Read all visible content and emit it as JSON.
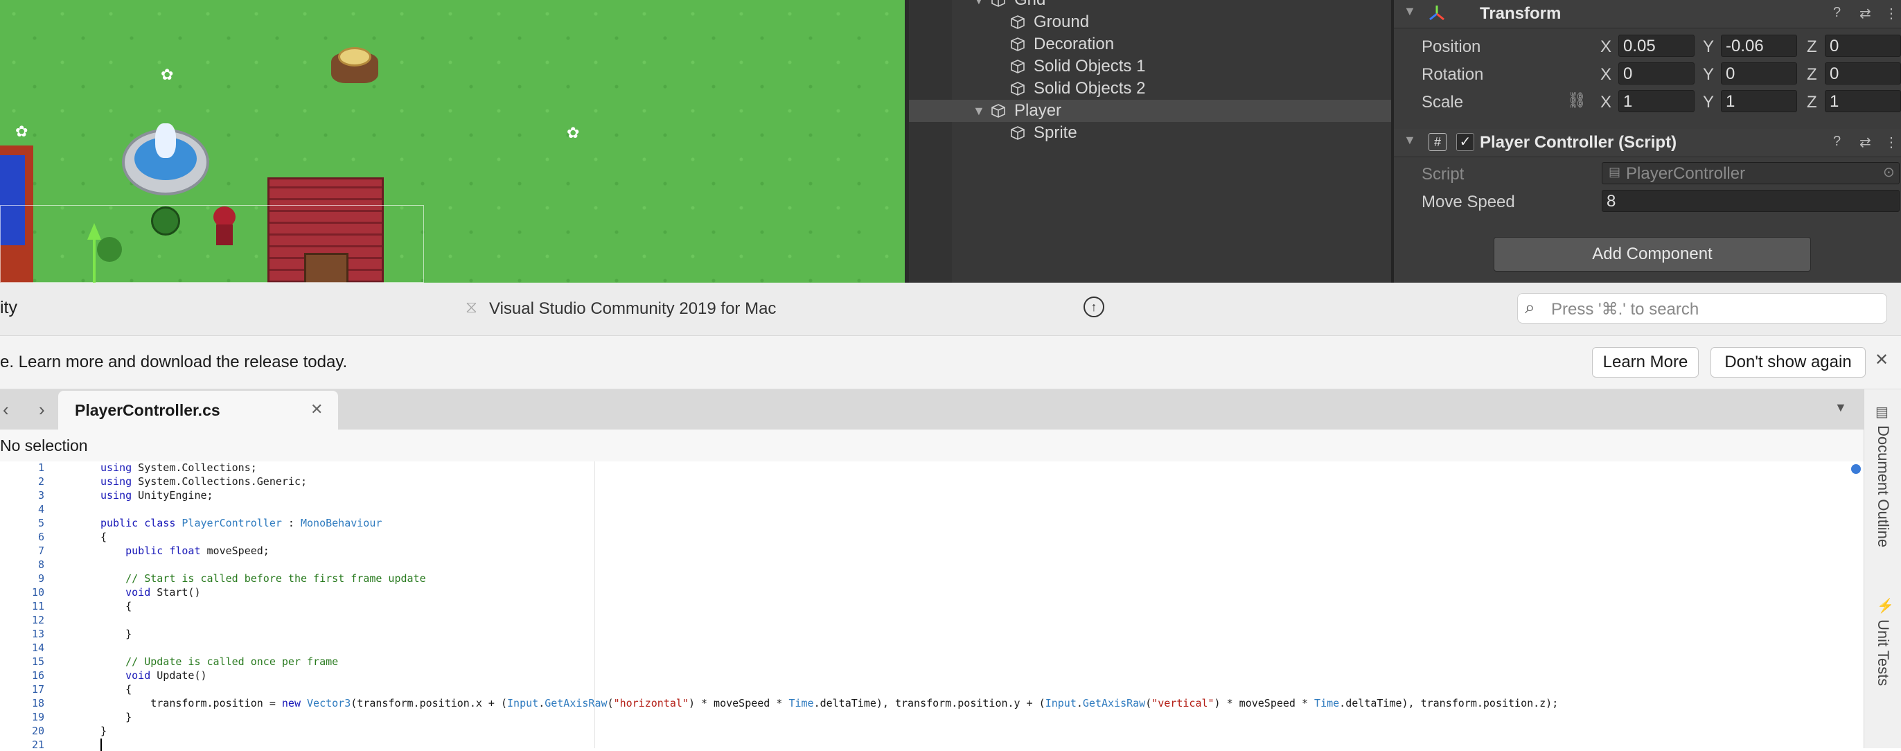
{
  "hierarchy": {
    "items": [
      {
        "label": "Grid"
      },
      {
        "label": "Ground"
      },
      {
        "label": "Decoration"
      },
      {
        "label": "Solid Objects 1"
      },
      {
        "label": "Solid Objects 2"
      },
      {
        "label": "Player"
      },
      {
        "label": "Sprite"
      }
    ]
  },
  "inspector": {
    "transform": {
      "title": "Transform",
      "position_label": "Position",
      "rotation_label": "Rotation",
      "scale_label": "Scale",
      "x_label": "X",
      "y_label": "Y",
      "z_label": "Z",
      "position": {
        "x": "0.05",
        "y": "-0.06",
        "z": "0"
      },
      "rotation": {
        "x": "0",
        "y": "0",
        "z": "0"
      },
      "scale": {
        "x": "1",
        "y": "1",
        "z": "1"
      }
    },
    "script_component": {
      "title": "Player Controller (Script)",
      "script_label": "Script",
      "script_value": "PlayerController",
      "move_speed_label": "Move Speed",
      "move_speed_value": "8"
    },
    "add_component_label": "Add Component"
  },
  "vs": {
    "app_partial": "ity",
    "window_title": "Visual Studio Community 2019 for Mac",
    "search_placeholder": "Press '⌘.' to search",
    "info_text": "e. Learn more and download the release today.",
    "learn_more_label": "Learn More",
    "dont_show_label": "Don't show again",
    "tab_label": "PlayerController.cs",
    "selection_text": "No selection",
    "document_outline_label": "Document Outline",
    "unit_tests_label": "Unit Tests"
  },
  "code": {
    "line_numbers": [
      "1",
      "2",
      "3",
      "4",
      "5",
      "6",
      "7",
      "8",
      "9",
      "10",
      "11",
      "12",
      "13",
      "14",
      "15",
      "16",
      "17",
      "18",
      "19",
      "20",
      "21"
    ],
    "l1a": "using",
    "l1b": " System.Collections;",
    "l2a": "using",
    "l2b": " System.Collections.Generic;",
    "l3a": "using",
    "l3b": " UnityEngine;",
    "l5a": "public class",
    "l5b": " PlayerController",
    "l5c": " : ",
    "l5d": "MonoBehaviour",
    "l6": "{",
    "l7a": "    public float",
    "l7b": " moveSpeed;",
    "l9": "    // Start is called before the first frame update",
    "l10a": "    void",
    "l10b": " Start()",
    "l11": "    {",
    "l13": "    }",
    "l15": "    // Update is called once per frame",
    "l16a": "    void",
    "l16b": " Update()",
    "l17": "    {",
    "l18a": "        transform.position = ",
    "l18b": "new",
    "l18c": " ",
    "l18d": "Vector3",
    "l18e": "(transform.position.x + (",
    "l18f": "Input",
    "l18g": ".",
    "l18h": "GetAxisRaw",
    "l18i": "(",
    "l18j": "\"horizontal\"",
    "l18k": ") * moveSpeed * ",
    "l18l": "Time",
    "l18m": ".deltaTime), transform.position.y + (",
    "l18n": "Input",
    "l18o": ".",
    "l18p": "GetAxisRaw",
    "l18q": "(",
    "l18r": "\"vertical\"",
    "l18s": ") * moveSpeed * ",
    "l18t": "Time",
    "l18u": ".deltaTime), transform.position.z);",
    "l19": "    }",
    "l20": "}"
  }
}
